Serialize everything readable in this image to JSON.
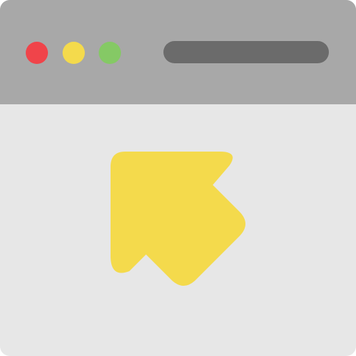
{
  "window": {
    "titlebar_color": "#a8a8a8",
    "content_color": "#e7e7e7",
    "buttons": [
      {
        "name": "close",
        "color": "#f0444a"
      },
      {
        "name": "minimize",
        "color": "#f4da4c"
      },
      {
        "name": "maximize",
        "color": "#85c965"
      }
    ],
    "address_bar_color": "#6b6b6b"
  },
  "icon": {
    "name": "cursor-arrow-up-left-icon",
    "color": "#f4da4c"
  }
}
